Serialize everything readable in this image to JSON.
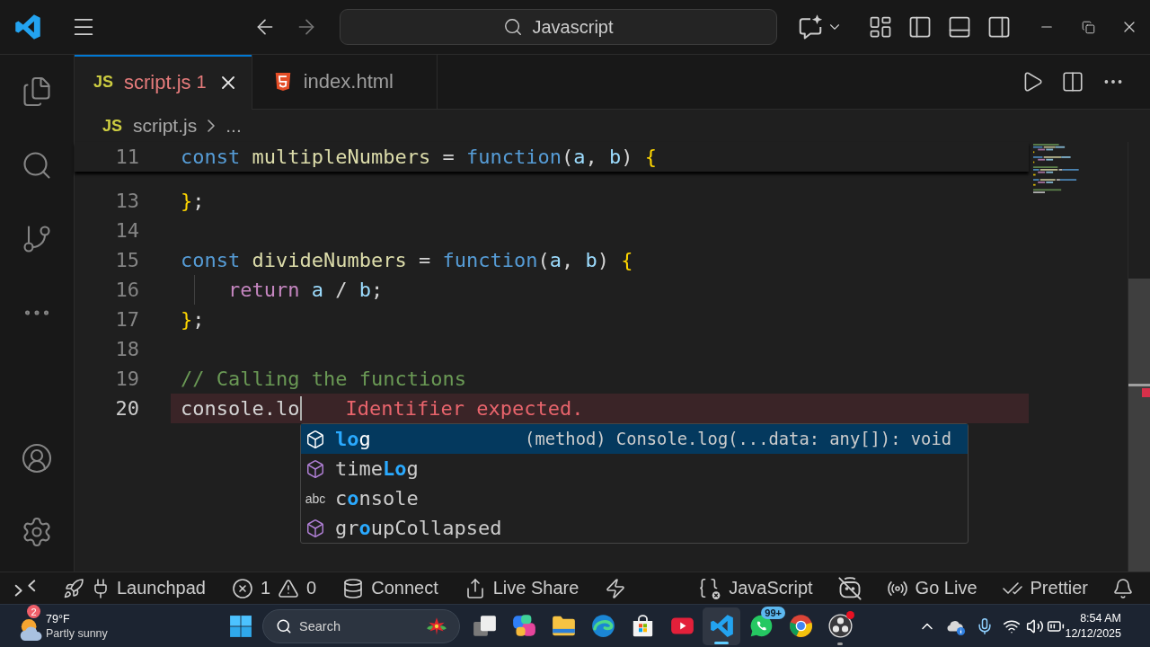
{
  "title_bar": {
    "nav": [
      {
        "kind": "back",
        "disabled": false
      },
      {
        "kind": "forward",
        "disabled": true
      }
    ],
    "command_center": {
      "label": "Javascript"
    }
  },
  "activity_bar": {
    "top": [
      {
        "kind": "explorer"
      },
      {
        "kind": "search"
      },
      {
        "kind": "source_control"
      },
      {
        "kind": "more"
      }
    ],
    "bottom": [
      {
        "kind": "accounts"
      },
      {
        "kind": "manage"
      }
    ]
  },
  "tabs": [
    {
      "kind": "js",
      "icon_text": "JS",
      "label": "script.js",
      "problems": "1",
      "error": true,
      "selected": true
    },
    {
      "kind": "html",
      "label": "index.html",
      "error": false,
      "selected": false
    }
  ],
  "breadcrumb": {
    "icon_text": "JS",
    "file": "script.js",
    "more": "..."
  },
  "editor": {
    "sticky_line": {
      "number": "11",
      "tokens": [
        {
          "kind": "keyword",
          "text": "const "
        },
        {
          "kind": "function",
          "text": "multipleNumbers"
        },
        {
          "kind": "punct",
          "text": " = "
        },
        {
          "kind": "keyword",
          "text": "function"
        },
        {
          "kind": "punct",
          "text": "("
        },
        {
          "kind": "param",
          "text": "a"
        },
        {
          "kind": "punct",
          "text": ", "
        },
        {
          "kind": "param",
          "text": "b"
        },
        {
          "kind": "punct",
          "text": ") "
        },
        {
          "kind": "brace",
          "text": "{"
        }
      ]
    },
    "lines": [
      {
        "number": "13",
        "current": false,
        "error": false,
        "indented": false,
        "tokens": [
          {
            "kind": "brace",
            "text": "}"
          },
          {
            "kind": "punct",
            "text": ";"
          }
        ]
      },
      {
        "number": "14",
        "current": false,
        "error": false,
        "indented": false
      },
      {
        "number": "15",
        "current": false,
        "error": false,
        "indented": false,
        "tokens": [
          {
            "kind": "keyword",
            "text": "const "
          },
          {
            "kind": "function",
            "text": "divideNumbers"
          },
          {
            "kind": "punct",
            "text": " = "
          },
          {
            "kind": "keyword",
            "text": "function"
          },
          {
            "kind": "punct",
            "text": "("
          },
          {
            "kind": "param",
            "text": "a"
          },
          {
            "kind": "punct",
            "text": ", "
          },
          {
            "kind": "param",
            "text": "b"
          },
          {
            "kind": "punct",
            "text": ") "
          },
          {
            "kind": "brace",
            "text": "{"
          }
        ]
      },
      {
        "number": "16",
        "current": false,
        "error": false,
        "indented": true,
        "tokens": [
          {
            "kind": "control",
            "text": "return "
          },
          {
            "kind": "param",
            "text": "a"
          },
          {
            "kind": "punct",
            "text": " / "
          },
          {
            "kind": "param",
            "text": "b"
          },
          {
            "kind": "punct",
            "text": ";"
          }
        ]
      },
      {
        "number": "17",
        "current": false,
        "error": false,
        "indented": false,
        "tokens": [
          {
            "kind": "brace",
            "text": "}"
          },
          {
            "kind": "punct",
            "text": ";"
          }
        ]
      },
      {
        "number": "18",
        "current": false,
        "error": false,
        "indented": false
      },
      {
        "number": "19",
        "current": false,
        "error": false,
        "indented": false,
        "tokens": [
          {
            "kind": "comment",
            "text": "// Calling the functions"
          }
        ]
      },
      {
        "number": "20",
        "current": true,
        "error": true,
        "indented": false,
        "diagnostic": "Identifier expected.",
        "tokens": [
          {
            "kind": "plain",
            "text": "console"
          },
          {
            "kind": "punct",
            "text": "."
          },
          {
            "kind": "plain",
            "text": "lo"
          }
        ]
      }
    ]
  },
  "suggest": {
    "items": [
      {
        "kind": "method",
        "selected": true,
        "label": [
          {
            "text": "lo",
            "match": true
          },
          {
            "text": "g",
            "match": false
          }
        ],
        "detail": "(method) Console.log(...data: any[]): void"
      },
      {
        "kind": "method",
        "selected": false,
        "label": [
          {
            "text": "time",
            "match": false
          },
          {
            "text": "Lo",
            "match": true
          },
          {
            "text": "g",
            "match": false
          }
        ]
      },
      {
        "kind": "text",
        "icon_text": "abc",
        "selected": false,
        "label": [
          {
            "text": "c",
            "match": false
          },
          {
            "text": "o",
            "match": true
          },
          {
            "text": "nsole",
            "match": false
          }
        ]
      },
      {
        "kind": "method",
        "selected": false,
        "label": [
          {
            "text": "gr",
            "match": false
          },
          {
            "text": "o",
            "match": true
          },
          {
            "text": "upCollapsed",
            "match": false
          }
        ]
      }
    ]
  },
  "status_bar": {
    "left": [
      {
        "kind": "remote"
      },
      {
        "kind": "launchpad",
        "label": "Launchpad"
      },
      {
        "kind": "problems",
        "errors": "1",
        "warnings": "0"
      },
      {
        "kind": "connect",
        "label": "Connect"
      },
      {
        "kind": "live_share",
        "label": "Live Share"
      },
      {
        "kind": "lightning"
      }
    ],
    "right": [
      {
        "kind": "language",
        "label": "JavaScript"
      },
      {
        "kind": "copilot_off"
      },
      {
        "kind": "go_live",
        "label": "Go Live"
      },
      {
        "kind": "prettier",
        "label": "Prettier"
      },
      {
        "kind": "notifications"
      }
    ]
  },
  "taskbar": {
    "weather": {
      "temperature": "79°F",
      "condition": "Partly sunny",
      "badge": "2"
    },
    "start": {
      "selected": false
    },
    "search": {
      "placeholder": "Search"
    },
    "apps": [
      {
        "kind": "task_view",
        "selected": false,
        "running": false,
        "notification": false
      },
      {
        "kind": "assistant",
        "selected": false,
        "running": false,
        "notification": false
      },
      {
        "kind": "folder",
        "selected": false,
        "running": false,
        "notification": false
      },
      {
        "kind": "browser",
        "selected": false,
        "running": false,
        "notification": false
      },
      {
        "kind": "store",
        "selected": false,
        "running": false,
        "notification": false
      },
      {
        "kind": "video",
        "selected": false,
        "running": false,
        "notification": false
      },
      {
        "kind": "editor",
        "selected": true,
        "running": true,
        "notification": false
      },
      {
        "kind": "chat",
        "selected": false,
        "running": false,
        "notification": false,
        "badge": "99+"
      },
      {
        "kind": "web",
        "selected": false,
        "running": false,
        "notification": false
      },
      {
        "kind": "recorder",
        "selected": false,
        "running": true,
        "notification": true
      }
    ],
    "tray": [
      {
        "kind": "hidden_icons"
      },
      {
        "kind": "cloud"
      },
      {
        "kind": "microphone"
      },
      {
        "kind": "wifi"
      },
      {
        "kind": "volume"
      },
      {
        "kind": "battery"
      }
    ],
    "clock": {
      "time": "8:54 AM",
      "date": "12/12/2025"
    }
  }
}
